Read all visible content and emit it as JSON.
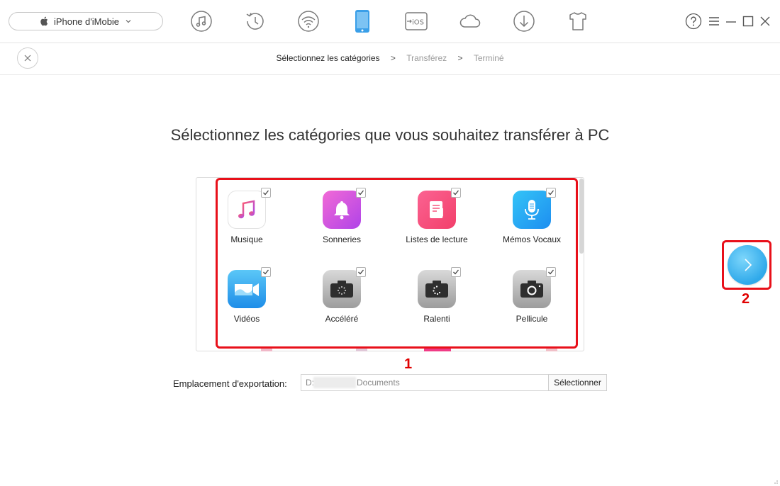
{
  "toolbar": {
    "device_name": "iPhone d'iMobie",
    "icons": [
      "itunes-library-icon",
      "history-icon",
      "wifi-sync-icon",
      "iphone-icon",
      "ios-mover-icon",
      "icloud-icon",
      "download-icon",
      "tshirt-icon"
    ],
    "active_icon": "iphone-icon"
  },
  "breadcrumb": {
    "step1": "Sélectionnez les catégories",
    "sep": ">",
    "step2": "Transférez",
    "step3": "Terminé"
  },
  "main": {
    "title": "Sélectionnez les catégories que vous souhaitez transférer à PC",
    "categories": [
      {
        "label": "Musique",
        "icon": "music-note-icon",
        "checked": true
      },
      {
        "label": "Sonneries",
        "icon": "bell-icon",
        "checked": true
      },
      {
        "label": "Listes de lecture",
        "icon": "playlist-icon",
        "checked": true
      },
      {
        "label": "Mémos Vocaux",
        "icon": "microphone-icon",
        "checked": true
      },
      {
        "label": "Vidéos",
        "icon": "video-camera-icon",
        "checked": true
      },
      {
        "label": "Accéléré",
        "icon": "timelapse-camera-icon",
        "checked": true
      },
      {
        "label": "Ralenti",
        "icon": "slowmo-camera-icon",
        "checked": true
      },
      {
        "label": "Pellicule",
        "icon": "camera-icon",
        "checked": true
      }
    ],
    "annotation_1": "1",
    "annotation_2": "2"
  },
  "export": {
    "label": "Emplacement d'exportation:",
    "path_prefix": "D:",
    "path_suffix": "Documents",
    "select_label": "Sélectionner"
  },
  "colors": {
    "accent": "#2fa9ea",
    "annotation_red": "#e8101a"
  }
}
